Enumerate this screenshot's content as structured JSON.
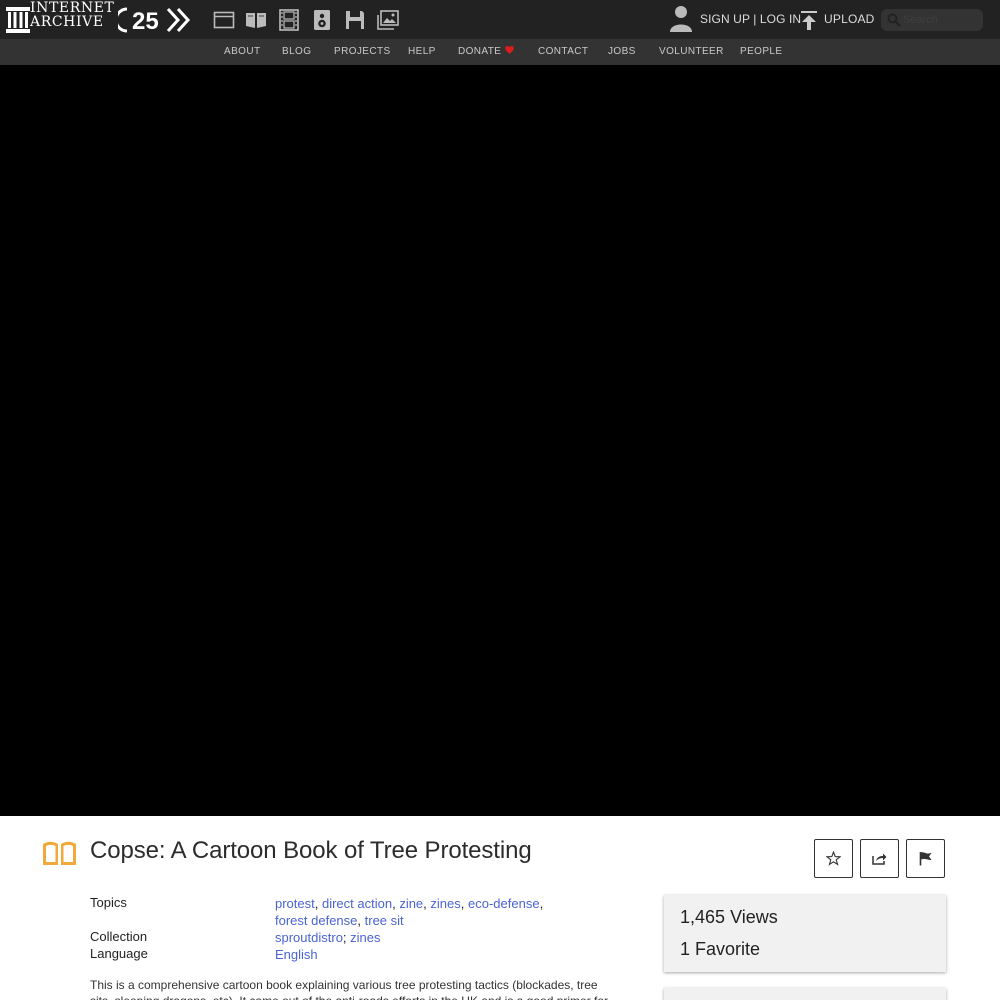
{
  "header": {
    "logo_line1": "INTERNET",
    "logo_line2": "ARCHIVE",
    "anniversary_badge_label": "25",
    "media_icons": [
      "web-icon",
      "texts-icon",
      "video-icon",
      "audio-icon",
      "software-icon",
      "images-icon"
    ],
    "signup_login": "SIGN UP | LOG IN",
    "upload_label": "UPLOAD",
    "search_placeholder": "Search"
  },
  "subnav": {
    "items": [
      "ABOUT",
      "BLOG",
      "PROJECTS",
      "HELP",
      "DONATE",
      "CONTACT",
      "JOBS",
      "VOLUNTEER",
      "PEOPLE"
    ],
    "donate_heart_color": "#e01b1b"
  },
  "item": {
    "type_icon": "book-icon",
    "type_icon_color": "#f0a93a",
    "title": "Copse: A Cartoon Book of Tree Protesting",
    "actions": [
      "favorite-icon",
      "share-icon",
      "flag-icon"
    ],
    "metadata": {
      "topics_label": "Topics",
      "topics": [
        "protest",
        "direct action",
        "zine",
        "zines",
        "eco-defense",
        "forest defense",
        "tree sit"
      ],
      "collection_label": "Collection",
      "collections": [
        "sproutdistro",
        "zines"
      ],
      "language_label": "Language",
      "language": "English"
    },
    "description": "This is a comprehensive cartoon book explaining various tree protesting tactics (blockades, tree sits, sleeping dragons, etc). It came out of the anti-roads efforts in the UK and is a good primer for people",
    "stats": {
      "views_count": "1,465",
      "views_label": "Views",
      "favorites_count": "1",
      "favorites_label": "Favorite"
    }
  },
  "colors": {
    "topbar_bg": "#222222",
    "subnav_bg": "#333333",
    "link": "#4b64d3",
    "viewer_bg": "#000000"
  }
}
